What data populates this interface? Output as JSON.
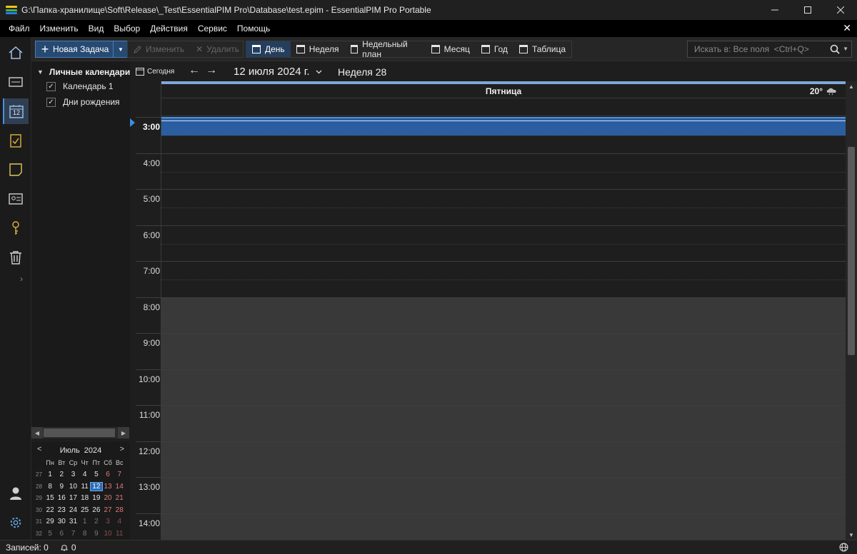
{
  "window": {
    "title": "G:\\Папка-хранилище\\Soft\\Release\\_Test\\EssentialPIM Pro\\Database\\test.epim - EssentialPIM Pro Portable",
    "logo_colors": [
      "#f5c518",
      "#3fb24a",
      "#2a7de1"
    ]
  },
  "menu": {
    "items": [
      "Файл",
      "Изменить",
      "Вид",
      "Выбор",
      "Действия",
      "Сервис",
      "Помощь"
    ],
    "close_glyph": "✕"
  },
  "rail": {
    "icons": [
      "home-icon",
      "notes-card-icon",
      "calendar-icon",
      "tasks-icon",
      "note-icon",
      "contacts-icon",
      "passwords-icon",
      "trash-icon",
      "user-icon",
      "settings-icon"
    ],
    "calendar_icon_day": "12"
  },
  "toolbar": {
    "new_task_label": "Новая Задача",
    "edit_label": "Изменить",
    "delete_label": "Удалить",
    "views": [
      {
        "label": "День",
        "active": true
      },
      {
        "label": "Неделя",
        "active": false
      },
      {
        "label": "Недельный план",
        "active": false
      },
      {
        "label": "Месяц",
        "active": false
      },
      {
        "label": "Год",
        "active": false
      },
      {
        "label": "Таблица",
        "active": false
      }
    ],
    "search_placeholder": "Искать в: Все поля  <Ctrl+Q>"
  },
  "calendars": {
    "group_label": "Личные календари",
    "items": [
      {
        "label": "Календарь 1",
        "checked": true
      },
      {
        "label": "Дни рождения",
        "checked": true
      }
    ]
  },
  "mini_calendar": {
    "month": "Июль",
    "year": "2024",
    "weekday_headers": [
      "Пн",
      "Вт",
      "Ср",
      "Чт",
      "Пт",
      "Сб",
      "Вс"
    ],
    "weeks": [
      {
        "week": "27",
        "days": [
          "1",
          "2",
          "3",
          "4",
          "5",
          "6",
          "7"
        ]
      },
      {
        "week": "28",
        "days": [
          "8",
          "9",
          "10",
          "11",
          "12",
          "13",
          "14"
        ]
      },
      {
        "week": "29",
        "days": [
          "15",
          "16",
          "17",
          "18",
          "19",
          "20",
          "21"
        ]
      },
      {
        "week": "30",
        "days": [
          "22",
          "23",
          "24",
          "25",
          "26",
          "27",
          "28"
        ]
      },
      {
        "week": "31",
        "days": [
          "29",
          "30",
          "31",
          "1",
          "2",
          "3",
          "4"
        ]
      },
      {
        "week": "32",
        "days": [
          "5",
          "6",
          "7",
          "8",
          "9",
          "10",
          "11"
        ]
      }
    ],
    "today": "12"
  },
  "day_nav": {
    "today_label": "Сегодня",
    "date_label": "12 июля 2024 г.",
    "week_label": "Неделя 28"
  },
  "day_view": {
    "day_name": "Пятница",
    "weather_temp": "20°",
    "hours": [
      "3:00",
      "4:00",
      "5:00",
      "6:00",
      "7:00",
      "8:00",
      "9:00",
      "10:00",
      "11:00",
      "12:00",
      "13:00",
      "14:00"
    ],
    "current_hour": "3:00",
    "work_start_hour": "8:00",
    "colors": {
      "off_hours": "#1e1e1e",
      "work_hours": "#393939",
      "now_band": "#2b5ea1"
    }
  },
  "status": {
    "records_label": "Записей: 0",
    "notifications_count": "0"
  }
}
